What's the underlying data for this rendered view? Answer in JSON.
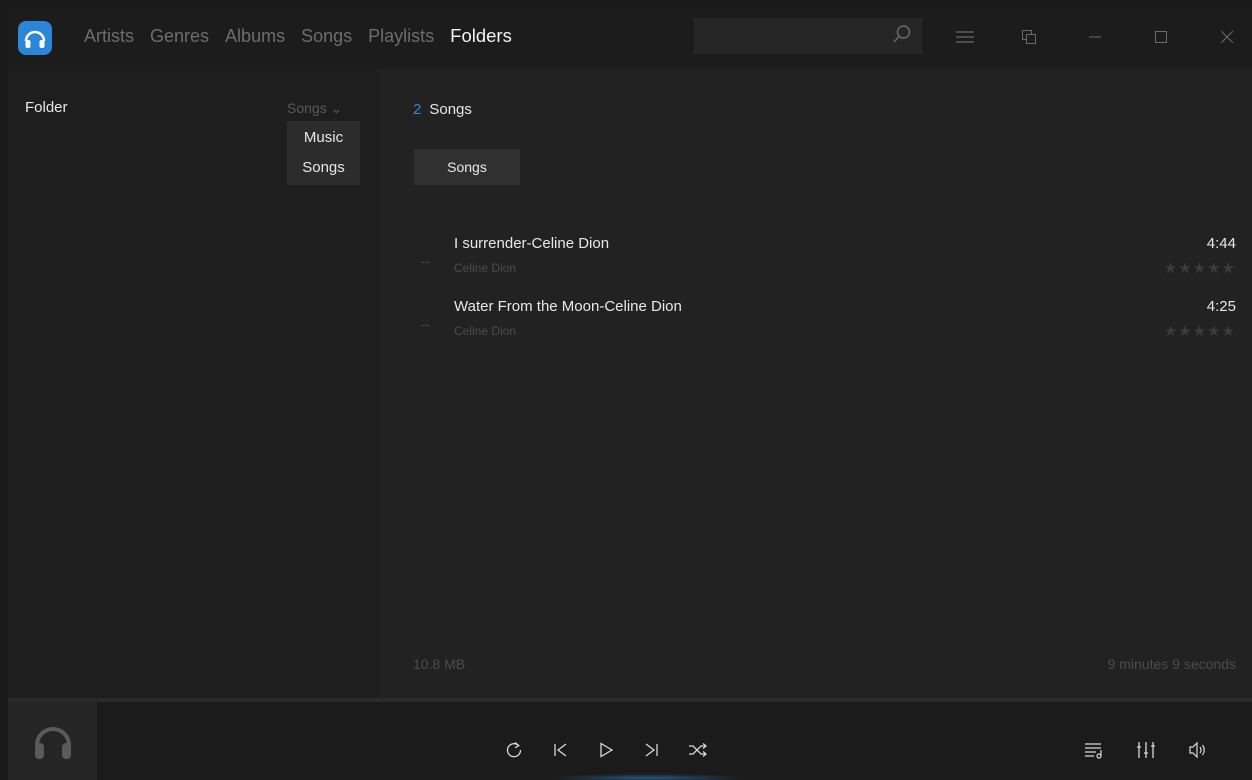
{
  "nav": {
    "items": [
      {
        "label": "Artists"
      },
      {
        "label": "Genres"
      },
      {
        "label": "Albums"
      },
      {
        "label": "Songs"
      },
      {
        "label": "Playlists"
      },
      {
        "label": "Folders",
        "active": true
      }
    ]
  },
  "search": {
    "value": "",
    "placeholder": ""
  },
  "left": {
    "folder_label": "Folder",
    "sort_value": "Songs ⌄",
    "dropdown_options": [
      "Music",
      "Songs"
    ]
  },
  "right": {
    "count": "2",
    "count_label": "Songs",
    "tab_label": "Songs",
    "songs": [
      {
        "dash": "--",
        "title": "I surrender-Celine Dion",
        "artist": "Celine Dion",
        "duration": "4:44",
        "stars": "★★★★★",
        "rating": 0
      },
      {
        "dash": "--",
        "title": "Water From the Moon-Celine Dion",
        "artist": "Celine Dion",
        "duration": "4:25",
        "stars": "★★★★★",
        "rating": 0
      }
    ],
    "total_size": "10.8 MB",
    "total_duration": "9 minutes 9 seconds"
  },
  "colors": {
    "accent": "#2b86d9"
  },
  "icons": {
    "titlebar": [
      "headphones-logo-icon",
      "search-icon",
      "hamburger-menu-icon",
      "mini-player-icon",
      "minimize-icon",
      "maximize-icon",
      "close-icon"
    ],
    "player": [
      "repeat-icon",
      "previous-icon",
      "play-icon",
      "next-icon",
      "shuffle-icon",
      "playlist-icon",
      "equalizer-icon",
      "volume-icon"
    ]
  }
}
